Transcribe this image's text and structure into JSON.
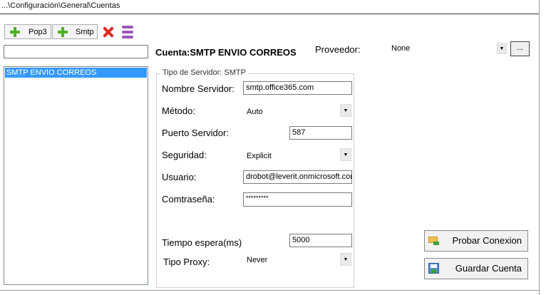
{
  "breadcrumb": "...\\Configuración\\General\\Cuentas",
  "toolbar": {
    "pop3_label": "Pop3",
    "smtp_label": "Smtp"
  },
  "search": {
    "value": ""
  },
  "accounts": {
    "items": [
      "SMTP ENVIO CORREOS"
    ]
  },
  "header": {
    "cuenta_label": "Cuenta:",
    "cuenta_value": "SMTP ENVIO CORREOS"
  },
  "proveedor": {
    "label": "Proveedor:",
    "value": "None",
    "browse_label": "..."
  },
  "server": {
    "group_title": "Tipo de Servidor: SMTP",
    "nombre_label": "Nombre Servidor:",
    "nombre_value": "smtp.office365.com",
    "metodo_label": "Método:",
    "metodo_value": "Auto",
    "puerto_label": "Puerto Servidor:",
    "puerto_value": "587",
    "seguridad_label": "Seguridad:",
    "seguridad_value": "Explicit",
    "usuario_label": "Usuario:",
    "usuario_value": "drobot@leverit.onmicrosoft.com",
    "password_label": "Comtraseña:",
    "password_value": "*********",
    "tiempo_label": "Tiempo espera(ms)",
    "tiempo_value": "5000",
    "proxy_label": "Tipo Proxy:",
    "proxy_value": "Never"
  },
  "actions": {
    "probar_label": "Probar Conexion",
    "guardar_label": "Guardar Cuenta"
  },
  "colors": {
    "accent": "#3399ff",
    "add": "#4cb321",
    "delete": "#e0281f",
    "database": "#9b59b6"
  }
}
